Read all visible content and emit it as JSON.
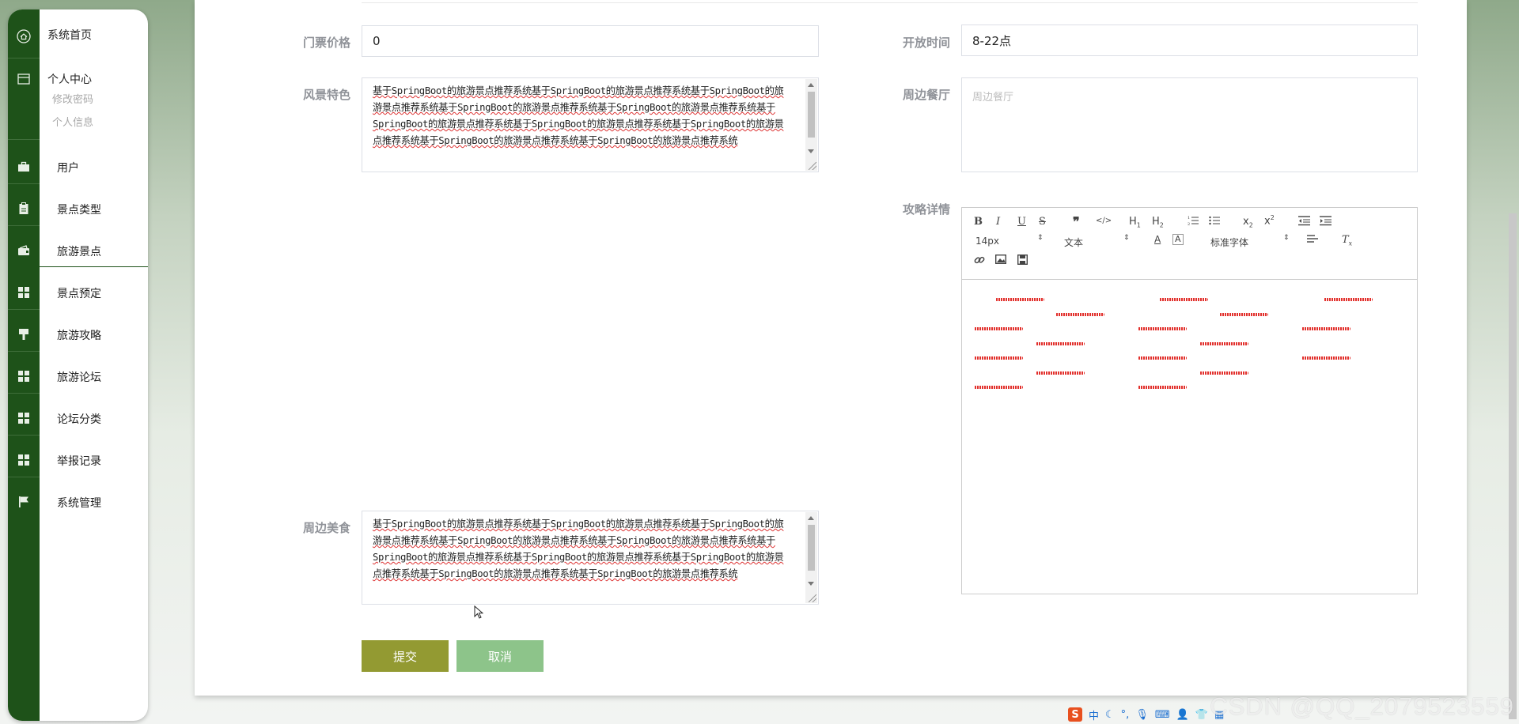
{
  "sidebar": {
    "home": "系统首页",
    "personal": "个人中心",
    "sub_items": [
      "修改密码",
      "个人信息"
    ],
    "items": [
      {
        "label": "用户",
        "icon": "briefcase-icon"
      },
      {
        "label": "景点类型",
        "icon": "clipboard-icon"
      },
      {
        "label": "旅游景点",
        "icon": "wallet-icon"
      },
      {
        "label": "景点预定",
        "icon": "grid-icon"
      },
      {
        "label": "旅游攻略",
        "icon": "stamp-icon"
      },
      {
        "label": "旅游论坛",
        "icon": "grid-icon"
      },
      {
        "label": "论坛分类",
        "icon": "grid-icon"
      },
      {
        "label": "举报记录",
        "icon": "grid-icon"
      },
      {
        "label": "系统管理",
        "icon": "flag-icon"
      }
    ]
  },
  "form": {
    "price_label": "门票价格",
    "price_value": "0",
    "open_label": "开放时间",
    "open_value": "8-22点",
    "scenery_label": "风景特色",
    "scenery_value": "基于SpringBoot的旅游景点推荐系统基于SpringBoot的旅游景点推荐系统基于SpringBoot的旅游景点推荐系统基于SpringBoot的旅游景点推荐系统基于SpringBoot的旅游景点推荐系统基于SpringBoot的旅游景点推荐系统基于SpringBoot的旅游景点推荐系统基于SpringBoot的旅游景点推荐系统基于SpringBoot的旅游景点推荐系统基于SpringBoot的旅游景点推荐系统",
    "restaurant_label": "周边餐厅",
    "restaurant_placeholder": "周边餐厅",
    "guide_label": "攻略详情",
    "food_label": "周边美食",
    "food_value": "基于SpringBoot的旅游景点推荐系统基于SpringBoot的旅游景点推荐系统基于SpringBoot的旅游景点推荐系统基于SpringBoot的旅游景点推荐系统基于SpringBoot的旅游景点推荐系统基于SpringBoot的旅游景点推荐系统基于SpringBoot的旅游景点推荐系统基于SpringBoot的旅游景点推荐系统基于SpringBoot的旅游景点推荐系统基于SpringBoot的旅游景点推荐系统",
    "submit": "提交",
    "cancel": "取消"
  },
  "editor": {
    "font_size": "14px",
    "block_format": "文本",
    "font_family": "标准字体"
  },
  "tray": {
    "ime_logo": "S",
    "ime_mode": "中"
  },
  "watermark": "CSDN @QQ_2079523559"
}
